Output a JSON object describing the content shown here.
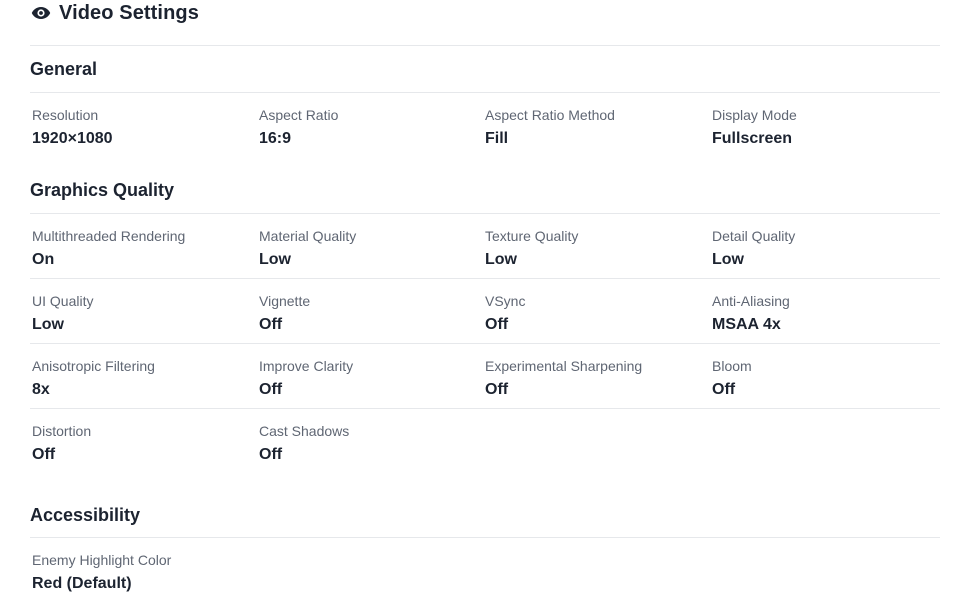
{
  "header": {
    "title": "Video Settings",
    "icon": "eye-icon"
  },
  "sections": {
    "general": {
      "title": "General",
      "items": [
        {
          "label": "Resolution",
          "value": "1920×1080"
        },
        {
          "label": "Aspect Ratio",
          "value": "16:9"
        },
        {
          "label": "Aspect Ratio Method",
          "value": "Fill"
        },
        {
          "label": "Display Mode",
          "value": "Fullscreen"
        }
      ]
    },
    "graphics": {
      "title": "Graphics Quality",
      "items": [
        {
          "label": "Multithreaded Rendering",
          "value": "On"
        },
        {
          "label": "Material Quality",
          "value": "Low"
        },
        {
          "label": "Texture Quality",
          "value": "Low"
        },
        {
          "label": "Detail Quality",
          "value": "Low"
        },
        {
          "label": "UI Quality",
          "value": "Low"
        },
        {
          "label": "Vignette",
          "value": "Off"
        },
        {
          "label": "VSync",
          "value": "Off"
        },
        {
          "label": "Anti-Aliasing",
          "value": "MSAA 4x"
        },
        {
          "label": "Anisotropic Filtering",
          "value": "8x"
        },
        {
          "label": "Improve Clarity",
          "value": "Off"
        },
        {
          "label": "Experimental Sharpening",
          "value": "Off"
        },
        {
          "label": "Bloom",
          "value": "Off"
        },
        {
          "label": "Distortion",
          "value": "Off"
        },
        {
          "label": "Cast Shadows",
          "value": "Off"
        }
      ]
    },
    "accessibility": {
      "title": "Accessibility",
      "items": [
        {
          "label": "Enemy Highlight Color",
          "value": "Red (Default)"
        }
      ]
    }
  },
  "colors": {
    "text_primary": "#1c2330",
    "text_label": "#5f6673",
    "divider": "#e6e8eb"
  }
}
